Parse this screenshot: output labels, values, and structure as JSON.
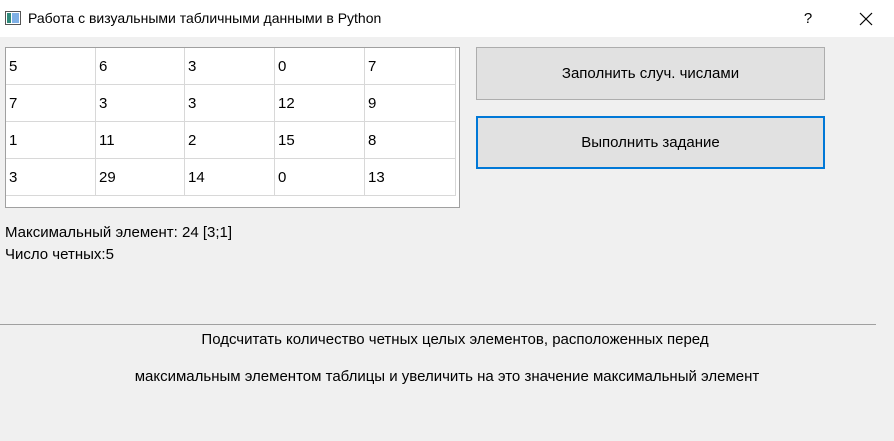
{
  "window": {
    "title": "Работа с визуальными табличными данными в Python",
    "help_label": "?"
  },
  "table": {
    "rows": [
      [
        "5",
        "6",
        "3",
        "0",
        "7"
      ],
      [
        "7",
        "3",
        "3",
        "12",
        "9"
      ],
      [
        "1",
        "11",
        "2",
        "15",
        "8"
      ],
      [
        "3",
        "29",
        "14",
        "0",
        "13"
      ]
    ]
  },
  "buttons": {
    "fill_random": "Заполнить случ. числами",
    "run_task": "Выполнить задание"
  },
  "results": {
    "max_element": "Максимальный элемент: 24 [3;1]",
    "even_count": "Число четных:5"
  },
  "task": {
    "line1": "Подсчитать количество четных целых элементов, расположенных перед",
    "line2": "максимальным элементом таблицы и увеличить на это значение максимальный элемент"
  },
  "colors": {
    "focus_border": "#0078d7",
    "button_bg": "#e1e1e1",
    "window_bg": "#f0f0f0"
  }
}
